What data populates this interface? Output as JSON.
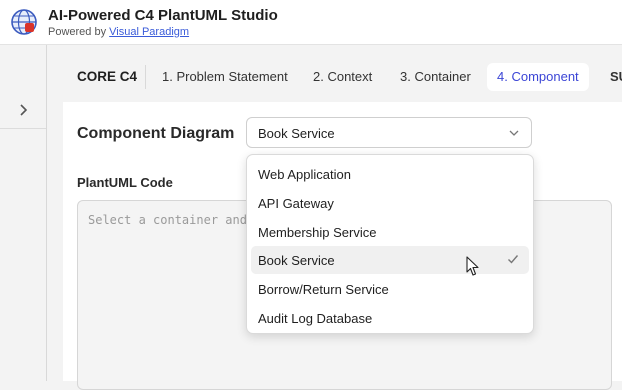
{
  "header": {
    "title": "AI-Powered C4 PlantUML Studio",
    "powered_prefix": "Powered by",
    "powered_link": "Visual Paradigm",
    "logo_icon": "globe-logo-icon"
  },
  "sidebar": {
    "expand_icon": "chevron-right-icon"
  },
  "tabs": {
    "core": "CORE C4",
    "items": [
      "1. Problem Statement",
      "2. Context",
      "3. Container",
      "4. Component",
      "SU"
    ],
    "active_index": 3
  },
  "panel": {
    "title": "Component Diagram",
    "select_value": "Book Service",
    "code_label": "PlantUML Code",
    "code_placeholder": "Select a container and"
  },
  "dropdown": {
    "options": [
      "Web Application",
      "API Gateway",
      "Membership Service",
      "Book Service",
      "Borrow/Return Service",
      "Audit Log Database"
    ],
    "selected_index": 3
  },
  "colors": {
    "accent": "#3c46d6",
    "link": "#3a5bd9",
    "selected_bg": "#f0f0f0"
  }
}
